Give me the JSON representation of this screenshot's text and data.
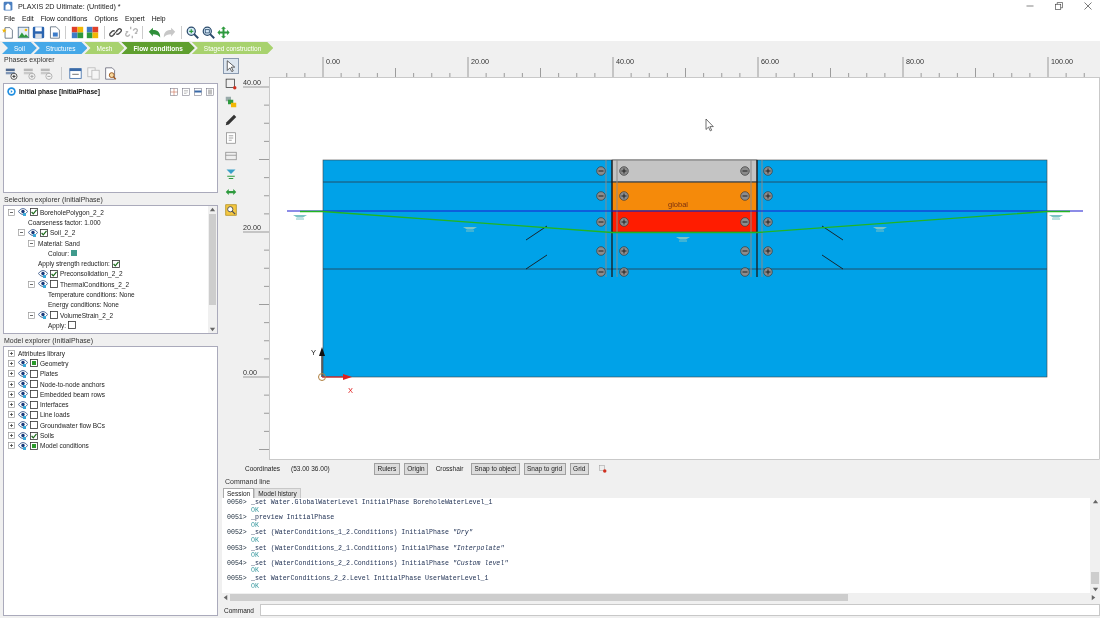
{
  "window": {
    "title": "PLAXIS 2D Ultimate: (Untitled) *"
  },
  "menu": [
    "File",
    "Edit",
    "Flow conditions",
    "Options",
    "Expert",
    "Help"
  ],
  "toolbar": [
    {
      "disabled": false
    },
    {
      "disabled": false
    },
    {
      "disabled": false
    },
    {
      "disabled": false
    },
    {
      "disabled": false
    },
    {
      "disabled": false
    },
    {
      "disabled": false
    },
    {
      "disabled": true
    },
    {
      "disabled": false
    },
    {
      "disabled": true
    },
    {
      "disabled": false
    },
    {
      "disabled": false
    },
    {
      "disabled": false
    }
  ],
  "mode_tabs": [
    {
      "label": "Soil",
      "kind": "geometry",
      "selected": false
    },
    {
      "label": "Structures",
      "kind": "geometry",
      "selected": false
    },
    {
      "label": "Mesh",
      "kind": "calculation",
      "selected": false
    },
    {
      "label": "Flow conditions",
      "kind": "calculation",
      "selected": true
    },
    {
      "label": "Staged construction",
      "kind": "calculation",
      "selected": false
    }
  ],
  "phases_explorer": {
    "title": "Phases explorer",
    "tools": [
      {
        "disabled": false
      },
      {
        "disabled": true
      },
      {
        "disabled": true
      },
      {
        "disabled": false
      },
      {
        "disabled": true
      },
      {
        "disabled": false
      }
    ],
    "phases": [
      {
        "label": "Initial phase [InitialPhase]"
      }
    ]
  },
  "selection_explorer": {
    "title": "Selection explorer (InitialPhase)",
    "tree": [
      {
        "kind": "object",
        "label": "BoreholePolygon_2_2",
        "checked": true,
        "expanded": true,
        "children": [
          {
            "kind": "property",
            "label": "Coarseness factor: 1.000"
          },
          {
            "kind": "object",
            "label": "Soil_2_2",
            "checked": true,
            "expanded": true,
            "children": [
              {
                "kind": "property",
                "label": "Material: Sand",
                "expanded": true,
                "children": [
                  {
                    "kind": "color_property",
                    "label": "Colour:",
                    "color": "#3f9a8c"
                  }
                ]
              },
              {
                "kind": "check_property",
                "label": "Apply strength reduction:",
                "checked": true
              },
              {
                "kind": "object",
                "label": "Preconsolidation_2_2",
                "checked": true
              },
              {
                "kind": "object",
                "label": "ThermalConditions_2_2",
                "checked": false,
                "expanded": true,
                "children": [
                  {
                    "kind": "property",
                    "label": "Temperature conditions: None"
                  },
                  {
                    "kind": "property",
                    "label": "Energy conditions: None"
                  }
                ]
              },
              {
                "kind": "object",
                "label": "VolumeStrain_2_2",
                "checked": false,
                "expanded": true,
                "children": [
                  {
                    "kind": "check_property",
                    "label": "Apply:",
                    "checked": false
                  }
                ]
              }
            ]
          }
        ]
      }
    ]
  },
  "model_explorer": {
    "title": "Model explorer (InitialPhase)",
    "tree": [
      {
        "kind": "folder",
        "label": "Attributes library",
        "expanded": false
      },
      {
        "kind": "object",
        "label": "Geometry",
        "checked": true,
        "partial": true,
        "expanded": false
      },
      {
        "kind": "object",
        "label": "Plates",
        "checked": false,
        "partial": false,
        "expanded": false
      },
      {
        "kind": "object",
        "label": "Node-to-node anchors",
        "checked": false,
        "partial": false,
        "expanded": false
      },
      {
        "kind": "object",
        "label": "Embedded beam rows",
        "checked": false,
        "partial": false,
        "expanded": false
      },
      {
        "kind": "object",
        "label": "Interfaces",
        "checked": false,
        "partial": false,
        "expanded": false
      },
      {
        "kind": "object",
        "label": "Line loads",
        "checked": false,
        "partial": false,
        "expanded": false
      },
      {
        "kind": "object",
        "label": "Groundwater flow BCs",
        "checked": false,
        "partial": false,
        "expanded": false
      },
      {
        "kind": "object",
        "label": "Soils",
        "checked": true,
        "partial": false,
        "expanded": false
      },
      {
        "kind": "object",
        "label": "Model conditions",
        "checked": true,
        "partial": true,
        "expanded": false
      }
    ]
  },
  "canvas": {
    "tools": [
      {
        "selected": true
      },
      {
        "selected": false
      },
      {
        "selected": false
      },
      {
        "selected": false
      },
      {
        "selected": false
      },
      {
        "selected": false
      },
      {
        "selected": false
      },
      {
        "selected": false
      },
      {
        "selected": false
      }
    ],
    "x_ruler": [
      "0.00",
      "20.00",
      "40.00",
      "60.00",
      "80.00",
      "100.00"
    ],
    "y_ruler": [
      "40.00",
      "20.00",
      "0.00"
    ],
    "water_level_label": "global",
    "y_axis_label": "Y",
    "x_axis_label": "X"
  },
  "coordinates": {
    "label": "Coordinates",
    "value": "(53.00 36.00)",
    "toggles": [
      {
        "label": "Rulers",
        "on": true
      },
      {
        "label": "Origin",
        "on": true
      },
      {
        "label": "Crosshair",
        "on": false
      },
      {
        "label": "Snap to object",
        "on": true
      },
      {
        "label": "Snap to grid",
        "on": true
      },
      {
        "label": "Grid",
        "on": true
      }
    ]
  },
  "command_line": {
    "title": "Command line",
    "tabs": [
      {
        "label": "Session",
        "selected": true
      },
      {
        "label": "Model history",
        "selected": false
      }
    ],
    "log": [
      {
        "prompt": "0050>",
        "command": "_set Water.GlobalWaterLevel InitialPhase BoreholeWaterLevel_1",
        "result": "OK"
      },
      {
        "prompt": "0051>",
        "command": "_preview InitialPhase",
        "result": "OK"
      },
      {
        "prompt": "0052>",
        "command": "_set (WaterConditions_1_2.Conditions) InitialPhase *\"Dry\"*",
        "result": "OK"
      },
      {
        "prompt": "0053>",
        "command": "_set (WaterConditions_2_1.Conditions) InitialPhase *\"Interpolate\"*",
        "result": "OK"
      },
      {
        "prompt": "0054>",
        "command": "_set (WaterConditions_2_2.Conditions) InitialPhase *\"Custom level\"*",
        "result": "OK"
      },
      {
        "prompt": "0055>",
        "command": "_set WaterConditions_2_2.Level InitialPhase UserWaterLevel_1",
        "result": "OK"
      }
    ],
    "input_label": "Command"
  }
}
